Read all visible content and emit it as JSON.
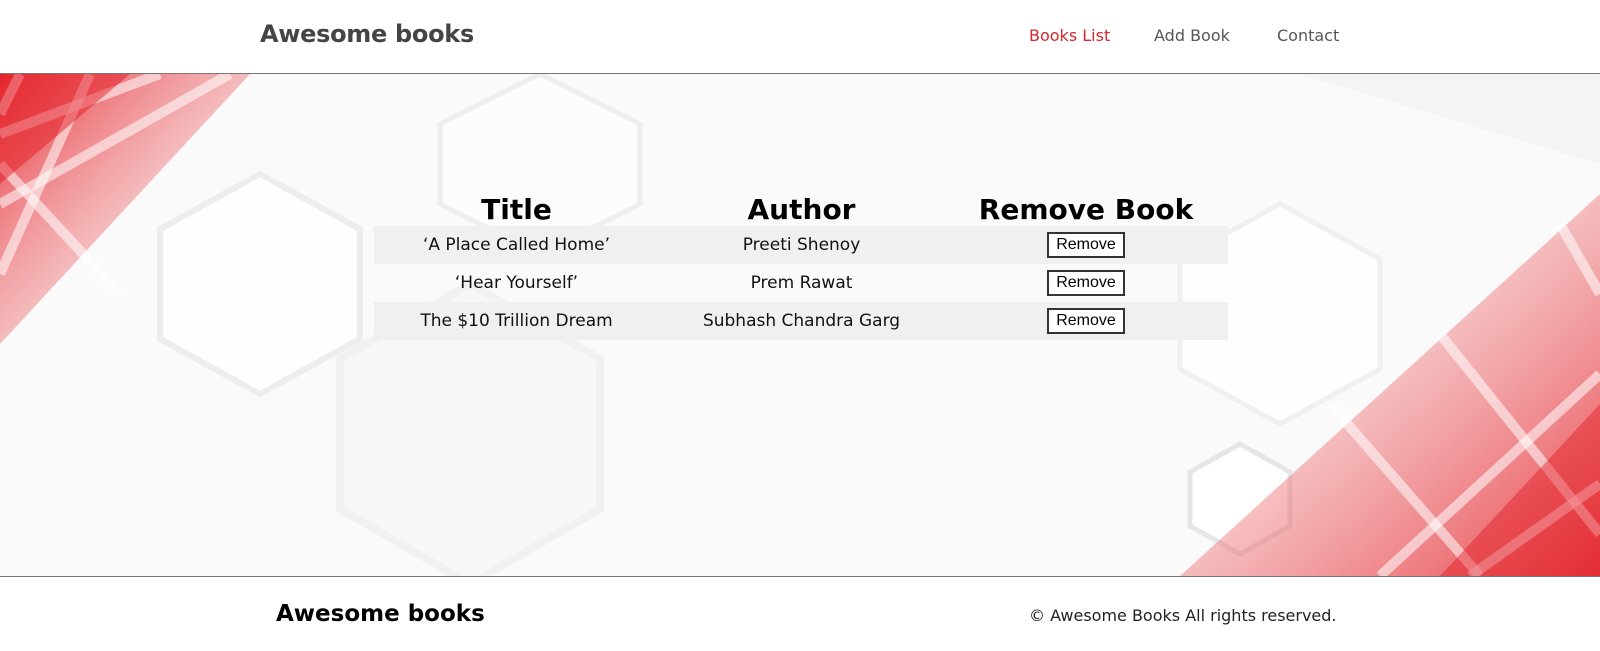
{
  "header": {
    "brand": "Awesome books",
    "nav": [
      {
        "label": "Books List",
        "active": true
      },
      {
        "label": "Add Book",
        "active": false
      },
      {
        "label": "Contact",
        "active": false
      }
    ]
  },
  "table": {
    "headers": [
      "Title",
      "Author",
      "Remove Book"
    ],
    "rows": [
      {
        "title": "‘A Place Called Home’",
        "author": "Preeti Shenoy",
        "action": "Remove"
      },
      {
        "title": "‘Hear Yourself’",
        "author": "Prem Rawat",
        "action": "Remove"
      },
      {
        "title": "The $10 Trillion Dream",
        "author": "Subhash Chandra Garg",
        "action": "Remove"
      }
    ]
  },
  "footer": {
    "brand": "Awesome books",
    "copyright": "© Awesome Books All rights reserved."
  },
  "colors": {
    "accent": "#d6272e",
    "nav_text": "#555555",
    "stripe": "#f0f0f0"
  }
}
